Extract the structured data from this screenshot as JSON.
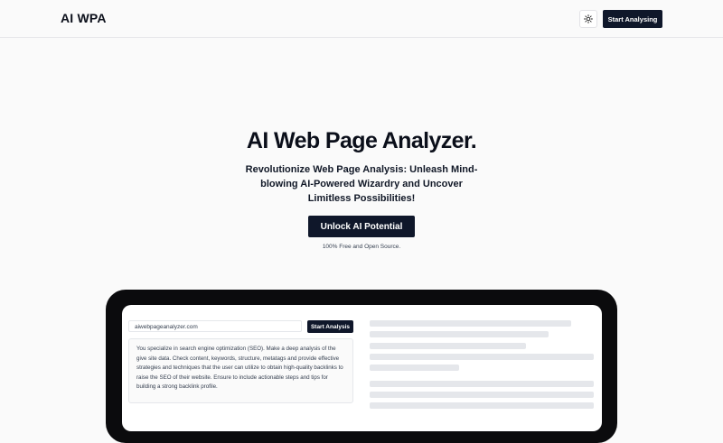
{
  "header": {
    "logo": "AI WPA",
    "theme_toggle_icon": "sun-icon",
    "cta_label": "Start Analysing"
  },
  "hero": {
    "title": "AI Web Page Analyzer.",
    "subtitle": "Revolutionize Web Page Analysis: Unleash Mind-blowing AI-Powered Wizardry and Uncover Limitless Possibilities!",
    "cta_label": "Unlock AI Potential",
    "tagline": "100% Free and Open Source."
  },
  "demo": {
    "url_value": "aiwebpageanalyzer.com",
    "analyze_label": "Start Analysis",
    "prompt_text": "You specialize in search engine optimization (SEO). Make a deep analysis of the give site data. Check content, keywords, structure, metatags and provide effective strategies and techniques that the user can utilize to obtain high-quality backlinks to raise the SEO of their website. Ensure to include actionable steps and tips for building a strong backlink profile."
  },
  "colors": {
    "background": "#fafafa",
    "primary": "#0f172a",
    "device_frame": "#0b0b0d",
    "skeleton": "#e5e7eb"
  }
}
